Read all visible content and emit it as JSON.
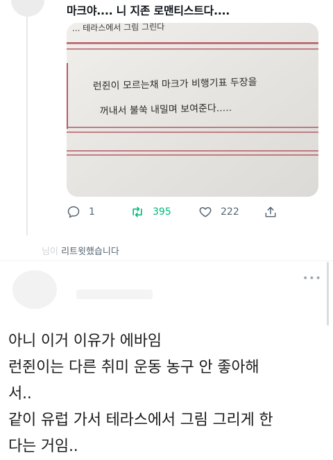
{
  "tweet": {
    "text": "마크야.... 니 지존 로맨티스트다....",
    "image_handwriting": {
      "line_top": "... 테라스에서 그림 그린다",
      "line1": "런쥔이 모르는채 마크가 비행기표 두장을",
      "line2": "꺼내서 불쑥 내밀며 보여준다....."
    },
    "actions": {
      "reply_count": "1",
      "retweet_count": "395",
      "like_count": "222"
    }
  },
  "retweet_notice": {
    "blurred": "님이",
    "text": "리트윗했습니다"
  },
  "second_tweet": {
    "more_label": "•••"
  },
  "comment": {
    "lines": [
      "아니 이거 이유가 에바임",
      "런쥔이는 다른 취미 운동 농구 안 좋아해",
      "서..",
      "같이 유럽 가서 테라스에서 그림 그리게 한",
      "다는 거임.."
    ]
  },
  "colors": {
    "retweet_green": "#00ba7c",
    "action_gray": "#536471",
    "paper": "#efede9",
    "red_line": "#b55a63"
  }
}
